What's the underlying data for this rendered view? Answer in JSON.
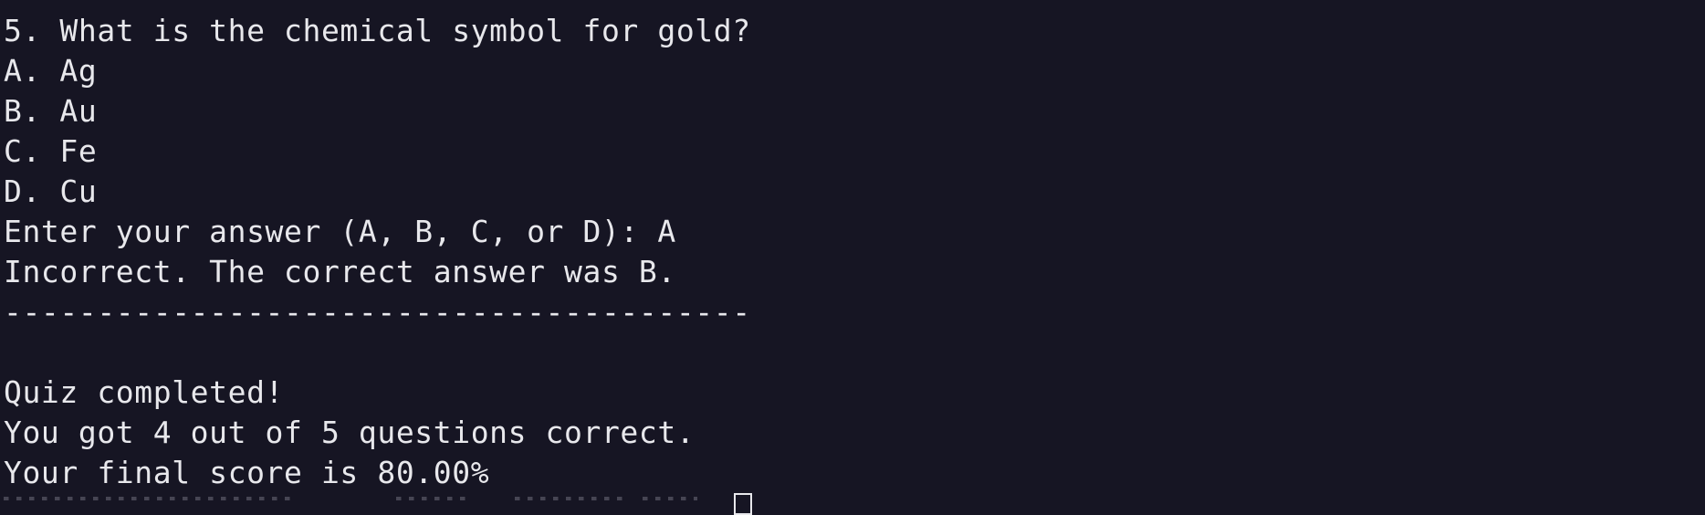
{
  "terminal": {
    "question": "5. What is the chemical symbol for gold?",
    "options": [
      "A. Ag",
      "B. Au",
      "C. Fe",
      "D. Cu"
    ],
    "prompt": "Enter your answer (A, B, C, or D): A",
    "feedback": "Incorrect. The correct answer was B.",
    "separator": "----------------------------------------",
    "blank": "",
    "completed": "Quiz completed!",
    "summary": "You got 4 out of 5 questions correct.",
    "score": "Your final score is 80.00%"
  },
  "colors": {
    "background": "#161523",
    "foreground": "#e8e8ec"
  }
}
